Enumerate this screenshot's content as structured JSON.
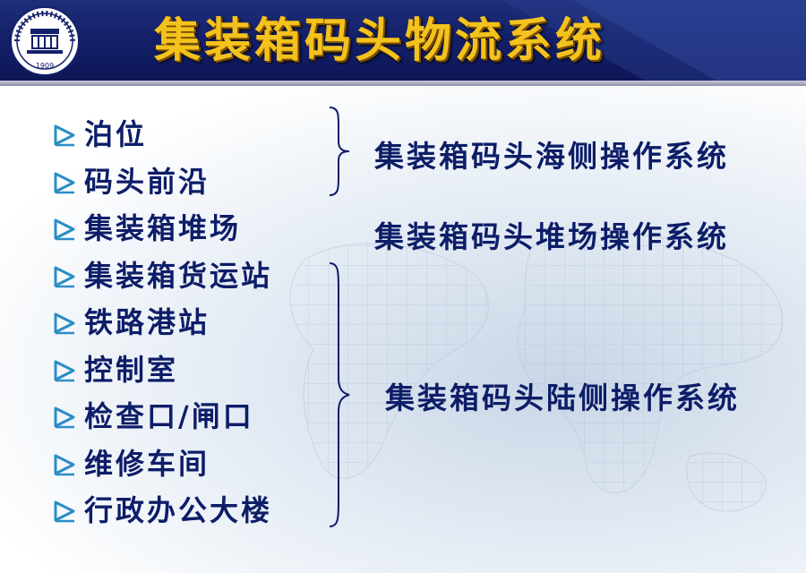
{
  "header": {
    "title": "集装箱码头物流系统",
    "logo": {
      "icon": "university-seal-icon",
      "year": "1909"
    }
  },
  "components": [
    "泊位",
    "码头前沿",
    "集装箱堆场",
    "集装箱货运站",
    "铁路港站",
    "控制室",
    "检查口/闸口",
    "维修车间",
    "行政办公大楼"
  ],
  "groups": [
    {
      "label": "集装箱码头海侧操作系统",
      "brace": true
    },
    {
      "label": "集装箱码头堆场操作系统",
      "brace": false
    },
    {
      "label": "集装箱码头陆侧操作系统",
      "brace": true
    }
  ],
  "colors": {
    "header_bg": "#14206a",
    "title": "#f4c21c",
    "text": "#0d1d68",
    "bullet": "#2a8dc6"
  }
}
